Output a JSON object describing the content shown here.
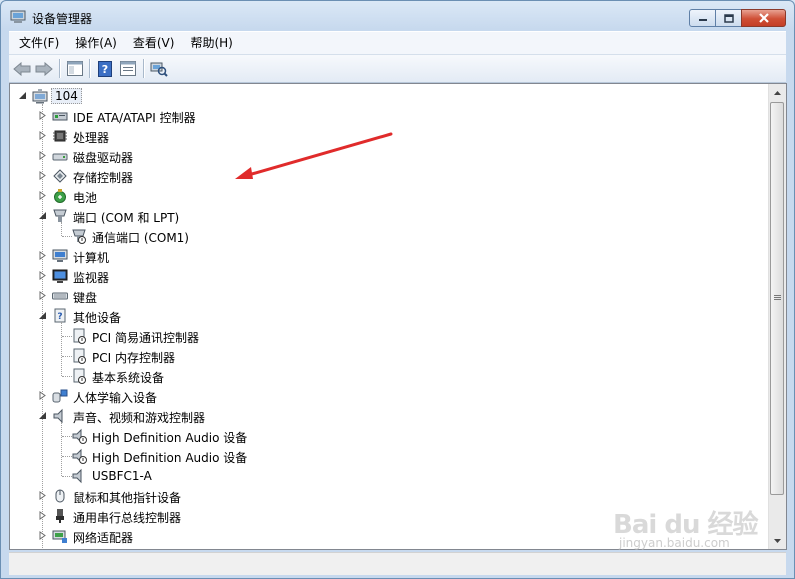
{
  "window": {
    "title": "设备管理器"
  },
  "menu": [
    "文件(F)",
    "操作(A)",
    "查看(V)",
    "帮助(H)"
  ],
  "tree": {
    "root": "104",
    "nodes": [
      {
        "label": "IDE ATA/ATAPI 控制器",
        "icon": "ide-controller-icon",
        "level": 1,
        "expander": "collapsed"
      },
      {
        "label": "处理器",
        "icon": "processor-icon",
        "level": 1,
        "expander": "collapsed"
      },
      {
        "label": "磁盘驱动器",
        "icon": "disk-drive-icon",
        "level": 1,
        "expander": "collapsed"
      },
      {
        "label": "存储控制器",
        "icon": "storage-controller-icon",
        "level": 1,
        "expander": "collapsed"
      },
      {
        "label": "电池",
        "icon": "battery-icon",
        "level": 1,
        "expander": "collapsed"
      },
      {
        "label": "端口 (COM 和 LPT)",
        "icon": "port-icon",
        "level": 1,
        "expander": "expanded"
      },
      {
        "label": "通信端口 (COM1)",
        "icon": "port-warning-icon",
        "level": 2,
        "expander": "none"
      },
      {
        "label": "计算机",
        "icon": "computer-icon",
        "level": 1,
        "expander": "collapsed"
      },
      {
        "label": "监视器",
        "icon": "monitor-icon",
        "level": 1,
        "expander": "collapsed"
      },
      {
        "label": "键盘",
        "icon": "keyboard-icon",
        "level": 1,
        "expander": "collapsed"
      },
      {
        "label": "其他设备",
        "icon": "unknown-device-icon",
        "level": 1,
        "expander": "expanded"
      },
      {
        "label": "PCI 简易通讯控制器",
        "icon": "unknown-device-warning-icon",
        "level": 2,
        "expander": "none"
      },
      {
        "label": "PCI 内存控制器",
        "icon": "unknown-device-warning-icon",
        "level": 2,
        "expander": "none"
      },
      {
        "label": "基本系统设备",
        "icon": "unknown-device-warning-icon",
        "level": 2,
        "expander": "none"
      },
      {
        "label": "人体学输入设备",
        "icon": "hid-icon",
        "level": 1,
        "expander": "collapsed"
      },
      {
        "label": "声音、视频和游戏控制器",
        "icon": "speaker-icon",
        "level": 1,
        "expander": "expanded"
      },
      {
        "label": "High Definition Audio 设备",
        "icon": "speaker-warning-icon",
        "level": 2,
        "expander": "none"
      },
      {
        "label": "High Definition Audio 设备",
        "icon": "speaker-warning-icon",
        "level": 2,
        "expander": "none"
      },
      {
        "label": "USBFC1-A",
        "icon": "speaker-icon",
        "level": 2,
        "expander": "none"
      },
      {
        "label": "鼠标和其他指针设备",
        "icon": "mouse-icon",
        "level": 1,
        "expander": "collapsed"
      },
      {
        "label": "通用串行总线控制器",
        "icon": "usb-icon",
        "level": 1,
        "expander": "collapsed"
      },
      {
        "label": "网络适配器",
        "icon": "network-adapter-icon",
        "level": 1,
        "expander": "collapsed"
      }
    ]
  },
  "watermark": {
    "text": "Bai du 经验",
    "sub": "jingyan.baidu.com"
  }
}
